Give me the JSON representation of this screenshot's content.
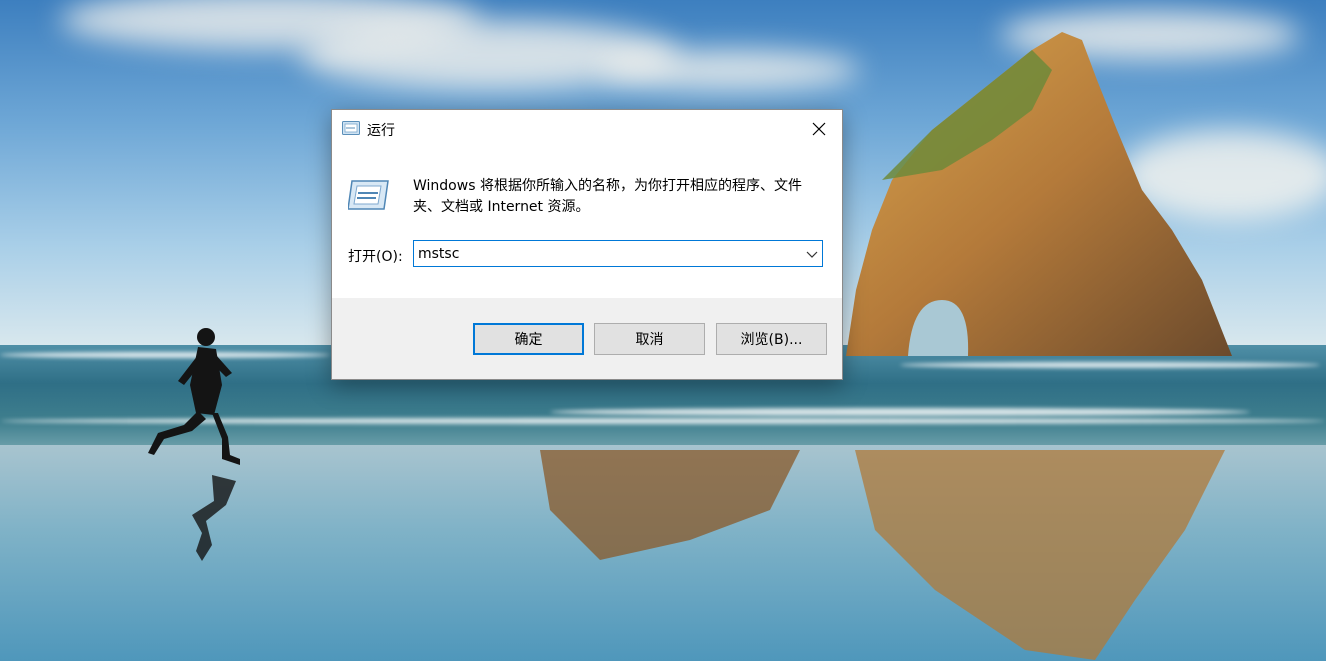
{
  "dialog": {
    "title": "运行",
    "description": "Windows 将根据你所输入的名称，为你打开相应的程序、文件夹、文档或 Internet 资源。",
    "open_label": "打开(O):",
    "open_value": "mstsc",
    "buttons": {
      "ok": "确定",
      "cancel": "取消",
      "browse": "浏览(B)..."
    }
  },
  "colors": {
    "accent": "#0078d7",
    "footer_bg": "#f0f0f0",
    "button_bg": "#e1e1e1"
  },
  "icons": {
    "title_icon": "run-icon",
    "big_icon": "run-icon",
    "close": "close-icon",
    "dropdown": "chevron-down-icon"
  }
}
